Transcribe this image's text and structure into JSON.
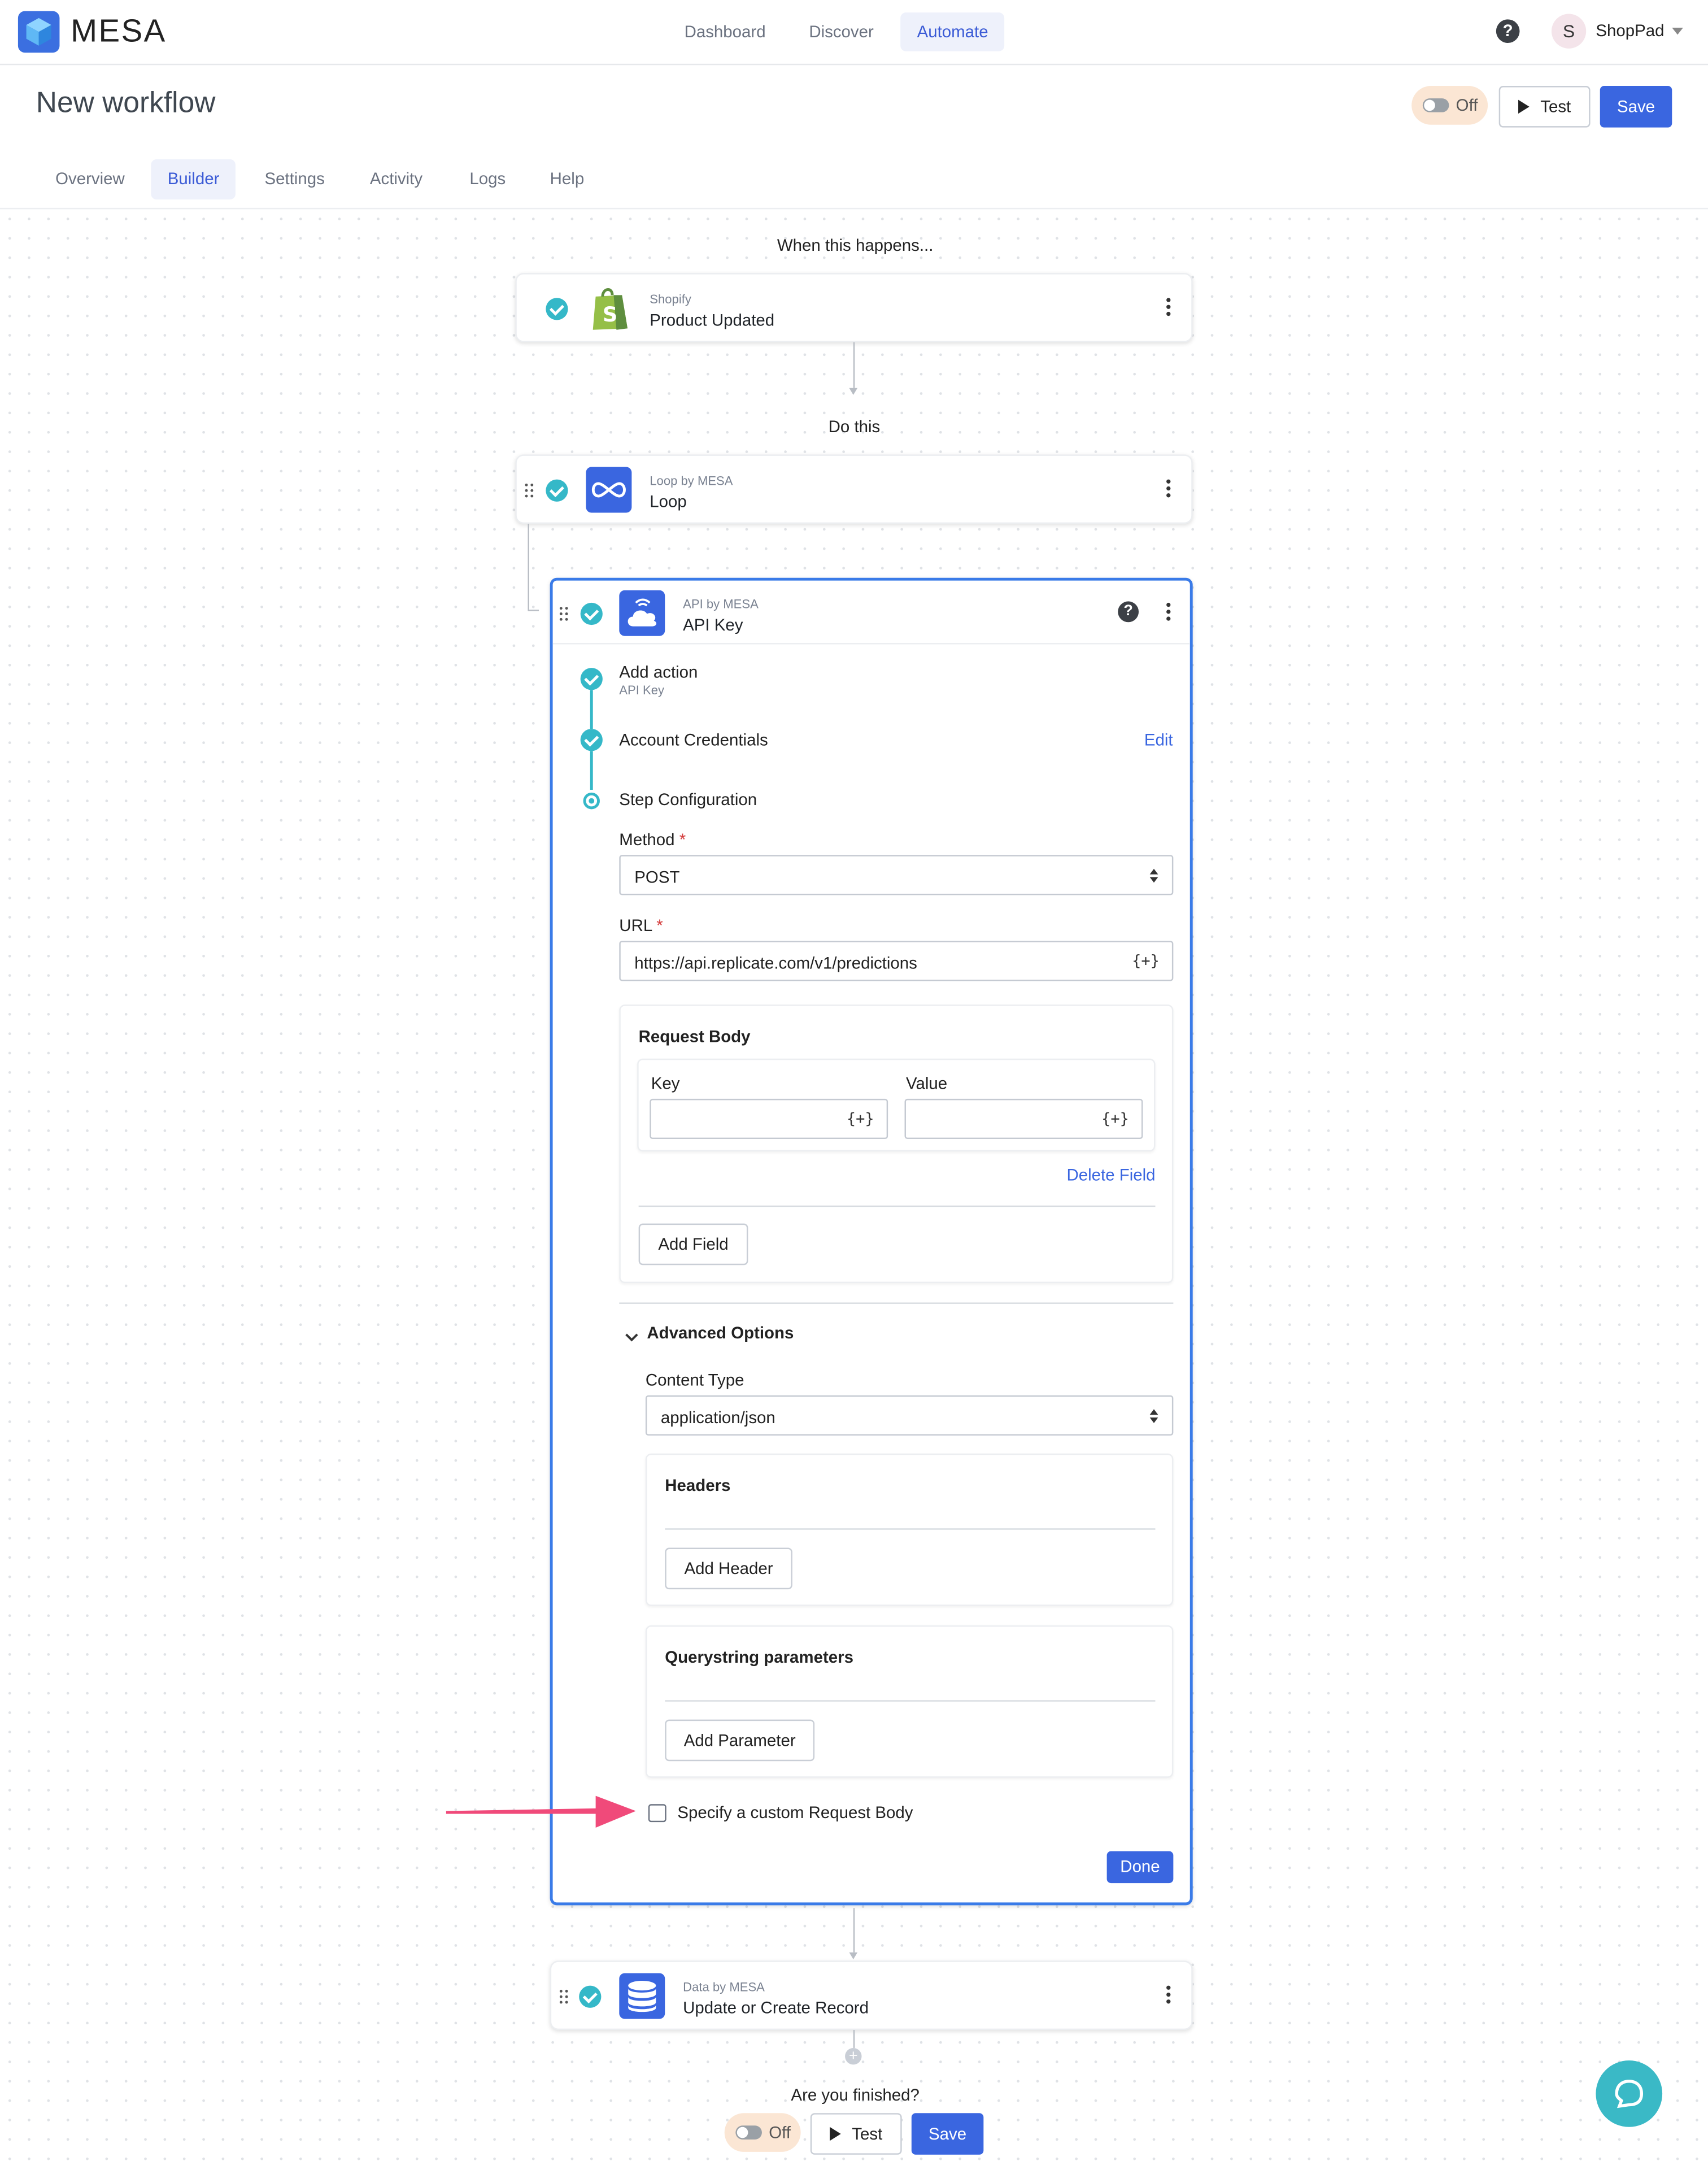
{
  "app": {
    "brand": "MESA",
    "accent": "#3a66e0",
    "teal": "#35b8c8"
  },
  "nav": {
    "items": [
      "Dashboard",
      "Discover",
      "Automate"
    ],
    "active": "Automate"
  },
  "account": {
    "initial": "S",
    "name": "ShopPad"
  },
  "page": {
    "title": "New workflow",
    "toggle_label": "Off",
    "test_label": "Test",
    "save_label": "Save"
  },
  "tabs": {
    "items": [
      "Overview",
      "Builder",
      "Settings",
      "Activity",
      "Logs",
      "Help"
    ],
    "active": "Builder"
  },
  "workflow": {
    "trigger_caption": "When this happens...",
    "trigger": {
      "app": "Shopify",
      "name": "Product Updated"
    },
    "actions_caption": "Do this",
    "loop": {
      "app": "Loop by MESA",
      "name": "Loop"
    },
    "api": {
      "app": "API by MESA",
      "name": "API Key",
      "steps": {
        "add_action": "Add action",
        "add_action_sub": "API Key",
        "credentials": "Account Credentials",
        "edit": "Edit",
        "config": "Step Configuration"
      },
      "method_label": "Method",
      "method_value": "POST",
      "url_label": "URL",
      "url_value": "https://api.replicate.com/v1/predictions",
      "var_token": "{+}",
      "request_body": {
        "title": "Request Body",
        "key_label": "Key",
        "value_label": "Value",
        "delete_field": "Delete Field",
        "add_field": "Add Field"
      },
      "advanced": {
        "title": "Advanced Options",
        "content_type_label": "Content Type",
        "content_type_value": "application/json",
        "headers_title": "Headers",
        "add_header": "Add Header",
        "qs_title": "Querystring parameters",
        "add_parameter": "Add Parameter"
      },
      "custom_body_label": "Specify a custom Request Body",
      "done": "Done"
    },
    "data": {
      "app": "Data by MESA",
      "name": "Update or Create Record"
    },
    "finish_caption": "Are you finished?",
    "footer_toggle": "Off",
    "footer_test": "Test",
    "footer_save": "Save"
  }
}
